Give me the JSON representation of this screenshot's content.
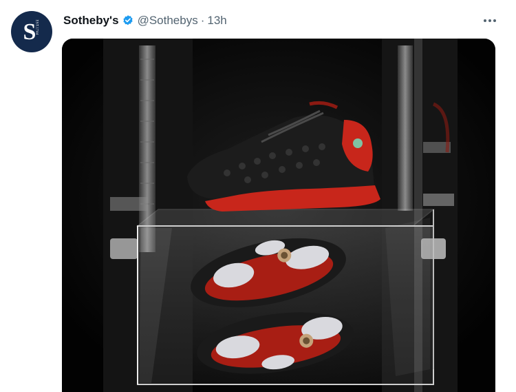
{
  "tweet": {
    "avatar": {
      "letter": "S",
      "est": "EST.1744"
    },
    "display_name": "Sotheby's",
    "handle": "@Sothebys",
    "separator": "·",
    "time": "13h",
    "verified_icon": "verified-badge-icon",
    "more_icon": "more-options-icon",
    "media": {
      "alt": "Black and red sneakers displayed in an acrylic case",
      "brand_colors": {
        "upper": "#1c1c1c",
        "accent": "#c8261b"
      }
    }
  },
  "colors": {
    "avatar_bg": "#142a4c",
    "verified": "#1d9bf0",
    "text": "#0f1419",
    "muted": "#536471"
  }
}
